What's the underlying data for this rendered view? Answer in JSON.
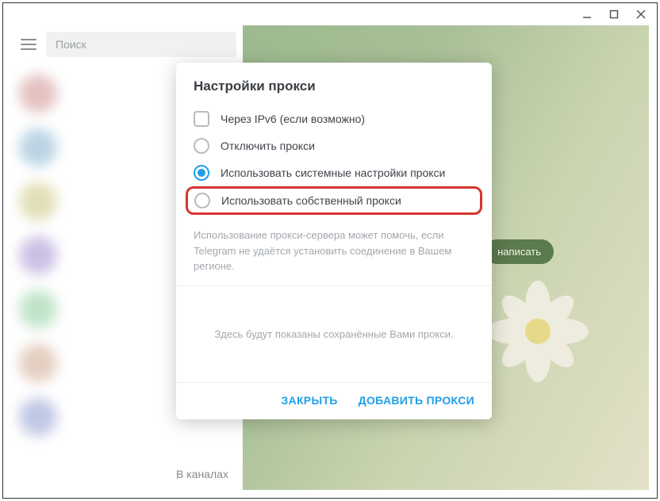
{
  "window": {
    "title": ""
  },
  "search": {
    "placeholder": "Поиск"
  },
  "main": {
    "pill_label": "написать"
  },
  "footer": {
    "channels_label": "В каналах"
  },
  "modal": {
    "title": "Настройки прокси",
    "options": {
      "ipv6": "Через IPv6 (если возможно)",
      "disable": "Отключить прокси",
      "system": "Использовать системные настройки прокси",
      "custom": "Использовать собственный прокси"
    },
    "selected": "system",
    "hint": "Использование прокси-сервера может помочь, если Telegram не удаётся установить соединение в Вашем регионе.",
    "saved_hint": "Здесь будут показаны сохранённые Вами прокси.",
    "close_label": "ЗАКРЫТЬ",
    "add_label": "ДОБАВИТЬ ПРОКСИ"
  },
  "colors": {
    "accent": "#1e9fe8",
    "highlight_border": "#d4362f"
  }
}
